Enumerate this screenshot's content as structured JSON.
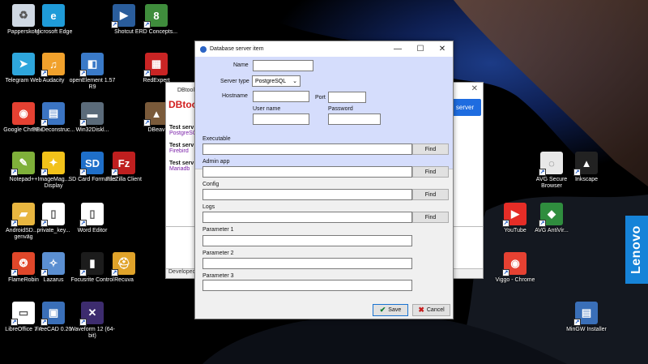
{
  "desktop_icons": [
    {
      "label": "Papperskorg",
      "icon": "recycle-bin-icon",
      "color": "#cfd8e3"
    },
    {
      "label": "Microsoft Edge",
      "icon": "edge-icon",
      "color": "#1f9bd8"
    },
    {
      "label": "Shotcut",
      "icon": "shotcut-icon",
      "color": "#2a5d9c"
    },
    {
      "label": "ERD Concepts...",
      "icon": "erd-concepts-icon",
      "color": "#3f8d3c"
    },
    {
      "label": "Telegram Web",
      "icon": "telegram-icon",
      "color": "#2ea6dc"
    },
    {
      "label": "Audacity",
      "icon": "audacity-icon",
      "color": "#f1a12c"
    },
    {
      "label": "openElement 1.57 R9",
      "icon": "openelement-icon",
      "color": "#3a7ac8"
    },
    {
      "label": "RedExpert",
      "icon": "redexpert-icon",
      "color": "#c92424"
    },
    {
      "label": "Google Chrome",
      "icon": "chrome-icon",
      "color": "#e54132"
    },
    {
      "label": "PE Deconstruc...",
      "icon": "pe-deconstructor-icon",
      "color": "#3b74c2"
    },
    {
      "label": "Win32Diskl...",
      "icon": "win32diskimager-icon",
      "color": "#5b6b7a"
    },
    {
      "label": "DBeav",
      "icon": "dbeaver-icon",
      "color": "#7a5a3a"
    },
    {
      "label": "Notepad++",
      "icon": "notepadpp-icon",
      "color": "#7fb03a"
    },
    {
      "label": "ImageMag... Display",
      "icon": "imagemagick-icon",
      "color": "#f2c21a"
    },
    {
      "label": "SD Card Formatter",
      "icon": "sd-card-icon",
      "color": "#1f6fc9"
    },
    {
      "label": "FileZilla Client",
      "icon": "filezilla-icon",
      "color": "#bf1f1f"
    },
    {
      "label": "AndroidSD... - genväg",
      "icon": "folder-icon",
      "color": "#e8b640"
    },
    {
      "label": "private_key...",
      "icon": "file-icon",
      "color": "#ffffff"
    },
    {
      "label": "Word Editor",
      "icon": "file-icon",
      "color": "#ffffff"
    },
    {
      "label": "FlameRobin",
      "icon": "flamerobin-icon",
      "color": "#e0472a"
    },
    {
      "label": "Lazarus",
      "icon": "lazarus-icon",
      "color": "#5b8fd1"
    },
    {
      "label": "Focusrite Control",
      "icon": "focusrite-icon",
      "color": "#1c1c1c"
    },
    {
      "label": "Recuva",
      "icon": "recuva-icon",
      "color": "#e0a32a"
    },
    {
      "label": "LibreOffice 7.4",
      "icon": "libreoffice-icon",
      "color": "#ffffff"
    },
    {
      "label": "FreeCAD 0.20",
      "icon": "freecad-icon",
      "color": "#3a6fb8"
    },
    {
      "label": "Waveform 12 (64-bit)",
      "icon": "waveform-icon",
      "color": "#3d2c6e"
    },
    {
      "label": "AVG Secure Browser",
      "icon": "avg-browser-icon",
      "color": "#e8e8e8"
    },
    {
      "label": "Inkscape",
      "icon": "inkscape-icon",
      "color": "#222222"
    },
    {
      "label": "YouTube",
      "icon": "youtube-icon",
      "color": "#e52d27"
    },
    {
      "label": "AVG AntiVir...",
      "icon": "avg-antivirus-icon",
      "color": "#2f8d3e"
    },
    {
      "label": "Viggo - Chrome",
      "icon": "chrome-icon",
      "color": "#e54132"
    },
    {
      "label": "MinGW Installer",
      "icon": "mingw-icon",
      "color": "#3a6fb8"
    }
  ],
  "background_window": {
    "title": "DBtool",
    "brand": "DBtoo",
    "server_button": "server",
    "servers": [
      {
        "name": "Test serv",
        "type": "PostgreSQ",
        "color": "#7a1fa8"
      },
      {
        "name": "Test serv",
        "type": "Firebird",
        "color": "#7a1fa8"
      },
      {
        "name": "Test serv",
        "type": "Mariadb",
        "color": "#7a1fa8"
      }
    ],
    "footer": "Developed"
  },
  "dialog": {
    "title": "Database server item",
    "fields": {
      "name_label": "Name",
      "name_value": "",
      "server_type_label": "Server type",
      "server_type_value": "PostgreSQL",
      "hostname_label": "Hostname",
      "hostname_value": "",
      "port_label": "Port",
      "port_value": "",
      "username_label": "User name",
      "username_value": "",
      "password_label": "Password",
      "password_value": ""
    },
    "paths": [
      {
        "label": "Executable",
        "value": "",
        "button": "Find"
      },
      {
        "label": "Admin app",
        "value": "",
        "button": "Find"
      },
      {
        "label": "Config",
        "value": "",
        "button": "Find"
      },
      {
        "label": "Logs",
        "value": "",
        "button": "Find"
      }
    ],
    "params": [
      {
        "label": "Parameter 1",
        "value": ""
      },
      {
        "label": "Parameter 2",
        "value": ""
      },
      {
        "label": "Parameter 3",
        "value": ""
      }
    ],
    "save_label": "Save",
    "cancel_label": "Cancel"
  },
  "brand_tab": "Lenovo",
  "colors": {
    "dialog_band": "#d5ddfc",
    "accent": "#1e6ce0",
    "lenovo": "#1683d8"
  }
}
